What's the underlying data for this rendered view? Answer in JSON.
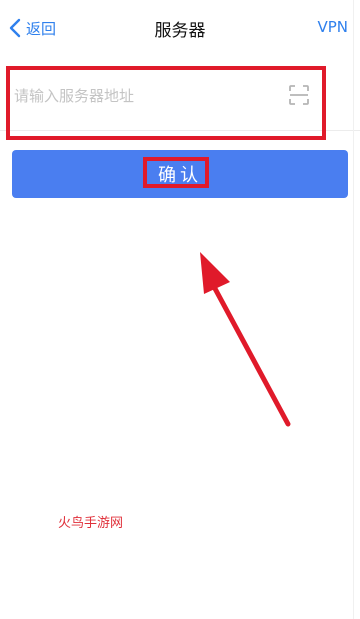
{
  "nav": {
    "back_label": "返回",
    "title": "服务器",
    "vpn_label": "VPN"
  },
  "form": {
    "server_placeholder": "请输入服务器地址",
    "server_value": ""
  },
  "confirm_label": "确认",
  "watermark": "火鸟手游网",
  "colors": {
    "accent": "#2f80ed",
    "button": "#4a7ef0",
    "annotation": "#e01a2a"
  },
  "icons": {
    "back": "chevron-left-icon",
    "scan": "scan-icon"
  }
}
